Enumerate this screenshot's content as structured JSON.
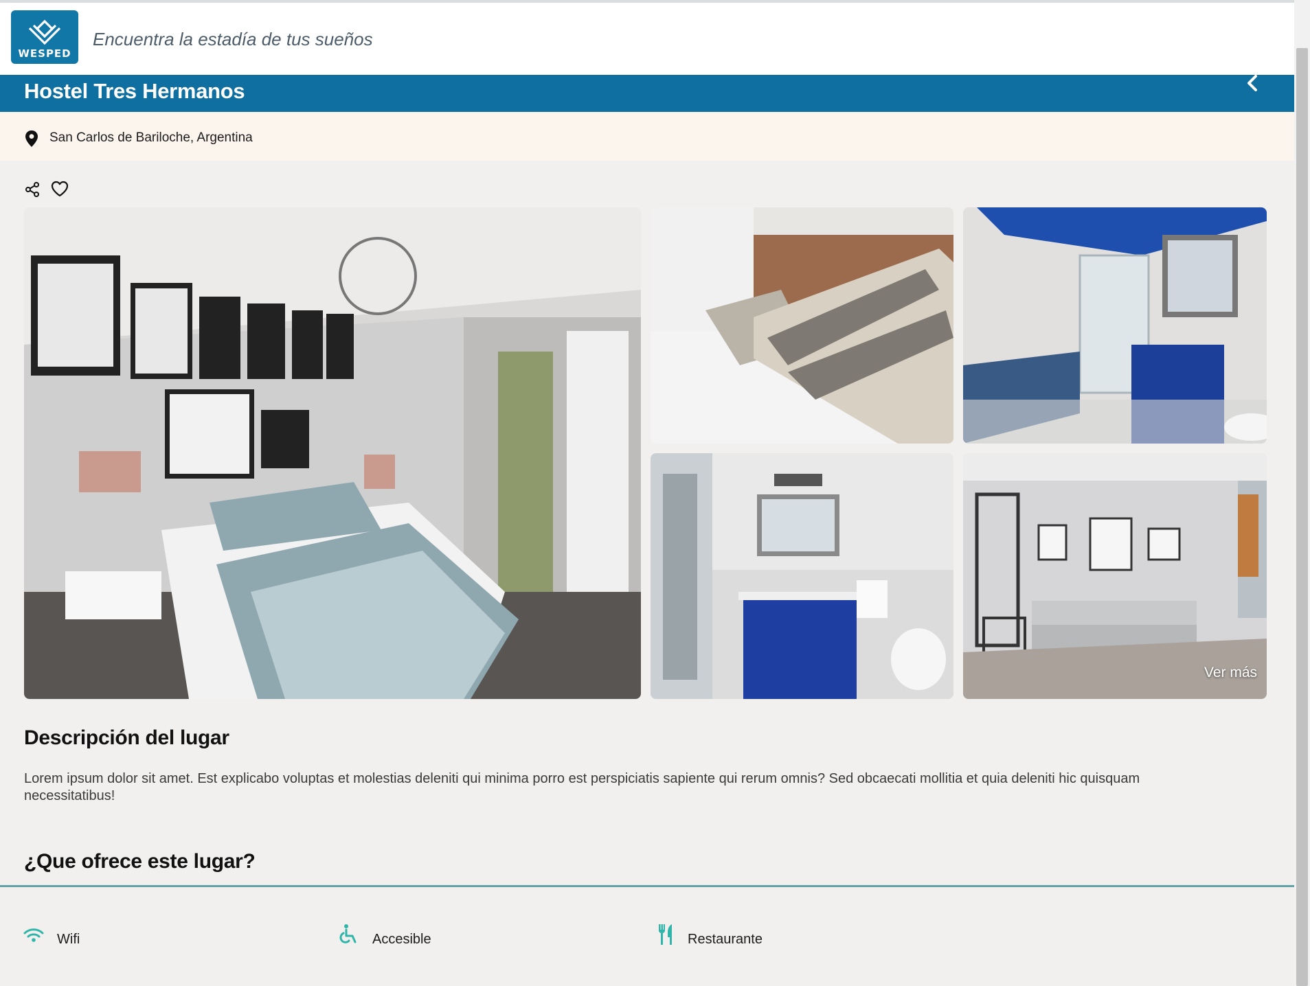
{
  "header": {
    "logo_text": "WESPED",
    "tagline": "Encuentra la estadía de tus sueños"
  },
  "listing": {
    "title": "Hostel Tres Hermanos",
    "location": "San Carlos de Bariloche, Argentina"
  },
  "gallery": {
    "see_more_label": "Ver más"
  },
  "description": {
    "heading": "Descripción del lugar",
    "text": "Lorem ipsum dolor sit amet. Est explicabo voluptas et molestias deleniti qui minima porro est perspiciatis sapiente qui rerum omnis? Sed obcaecati mollitia et quia deleniti hic quisquam necessitatibus!"
  },
  "amenities": {
    "heading": "¿Que ofrece este lugar?",
    "items": [
      {
        "label": "Wifi",
        "icon": "wifi-icon"
      },
      {
        "label": "Accesible",
        "icon": "accessible-icon"
      },
      {
        "label": "Restaurante",
        "icon": "restaurant-icon"
      }
    ]
  },
  "colors": {
    "brand": "#0f6fa1",
    "accent": "#2fb5a9",
    "location_bg": "#fcf5ee"
  }
}
